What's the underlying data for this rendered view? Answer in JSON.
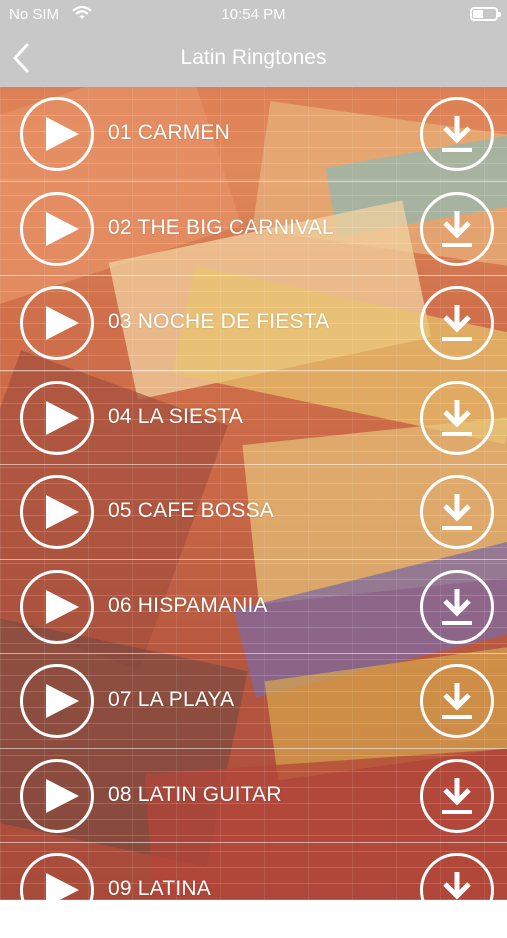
{
  "status_bar": {
    "carrier": "No SIM",
    "time": "10:54 PM",
    "wifi_icon": "wifi-icon",
    "battery_icon": "battery-icon"
  },
  "nav": {
    "title": "Latin Ringtones",
    "back_icon": "chevron-left-icon"
  },
  "ringtones": [
    {
      "name": "01 CARMEN"
    },
    {
      "name": "02 THE BIG CARNIVAL"
    },
    {
      "name": "03 NOCHE DE FIESTA"
    },
    {
      "name": "04 LA SIESTA"
    },
    {
      "name": "05 CAFE BOSSA"
    },
    {
      "name": "06 HISPAMANIA"
    },
    {
      "name": "07 LA PLAYA"
    },
    {
      "name": "08 LATIN GUITAR"
    },
    {
      "name": "09 LATINA"
    }
  ],
  "icons": {
    "play": "play-icon",
    "download": "download-icon"
  },
  "colors": {
    "bar_background": "#c8c8c8",
    "foreground": "#ffffff"
  }
}
